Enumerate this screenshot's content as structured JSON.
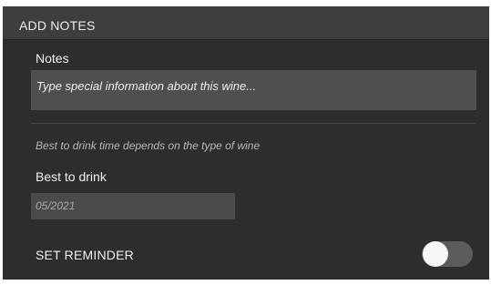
{
  "section": {
    "title": "ADD NOTES"
  },
  "notes": {
    "label": "Notes",
    "value": "Type special information about this wine..."
  },
  "hint": {
    "text": "Best to drink time depends on the type of wine"
  },
  "best_to_drink": {
    "label": "Best to drink",
    "value": "05/2021"
  },
  "reminder": {
    "label": "SET REMINDER",
    "enabled": false
  },
  "colors": {
    "panel_background": "#2d2d2d",
    "header_background": "#3e3e3e",
    "input_background": "#4f4f4f",
    "toggle_track_off": "#5c5c5c",
    "toggle_knob": "#f7f7f7"
  }
}
